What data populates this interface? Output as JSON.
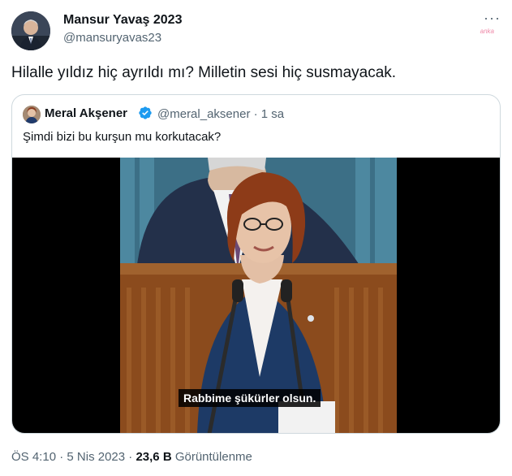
{
  "tweet": {
    "author_name": "Mansur Yavaş 2023",
    "author_handle": "@mansuryavas23",
    "more_icon": "more-horizontal-icon",
    "watermark": "anka",
    "text": "Hilalle yıldız hiç ayrıldı mı? Milletin sesi hiç susmayacak."
  },
  "quote": {
    "author_name": "Meral Akşener",
    "verified_icon": "verified-badge-icon",
    "author_handle": "@meral_aksener",
    "separator": "·",
    "time": "1 sa",
    "text": "Şimdi bizi bu kurşun mu korkutacak?",
    "video_subtitle": "Rabbime şükürler olsun."
  },
  "meta": {
    "time": "ÖS 4:10",
    "date": "5 Nis 2023",
    "views_count": "23,6 B",
    "views_label": "Görüntülenme",
    "sep": "·"
  },
  "colors": {
    "text": "#0f1419",
    "secondary": "#536471",
    "border": "#cfd9de",
    "verified": "#1d9bf0"
  }
}
